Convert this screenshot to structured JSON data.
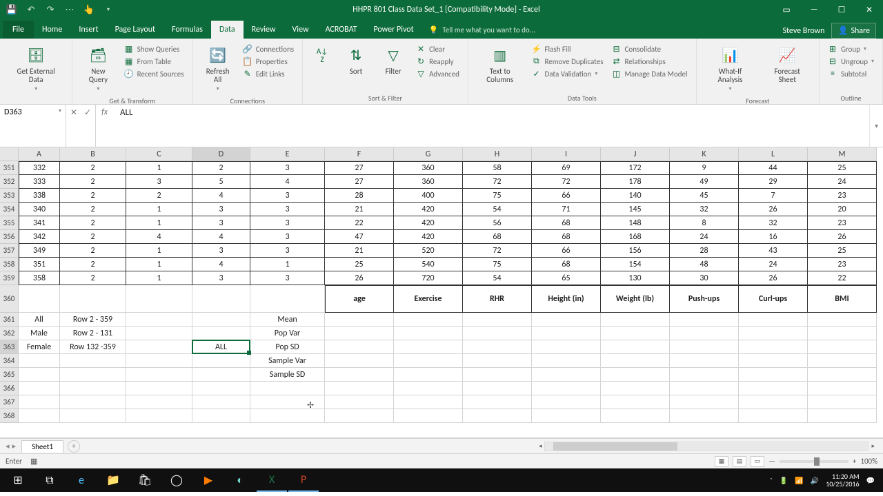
{
  "title": "HHPR 801 Class Data Set_1  [Compatibility Mode] - Excel",
  "user": "Steve Brown",
  "share": "Share",
  "tabs": {
    "file": "File",
    "home": "Home",
    "insert": "Insert",
    "pagelayout": "Page Layout",
    "formulas": "Formulas",
    "data": "Data",
    "review": "Review",
    "view": "View",
    "acrobat": "ACROBAT",
    "powerpivot": "Power Pivot"
  },
  "tellme": "Tell me what you want to do...",
  "ribbon": {
    "getdata": "Get External Data",
    "newquery": "New Query",
    "showqueries": "Show Queries",
    "fromtable": "From Table",
    "recent": "Recent Sources",
    "gt": "Get & Transform",
    "refresh": "Refresh All",
    "connections": "Connections",
    "properties": "Properties",
    "editlinks": "Edit Links",
    "conn": "Connections",
    "sort": "Sort",
    "filter": "Filter",
    "clear": "Clear",
    "reapply": "Reapply",
    "advanced": "Advanced",
    "sf": "Sort & Filter",
    "t2c": "Text to Columns",
    "flash": "Flash Fill",
    "dup": "Remove Duplicates",
    "valid": "Data Validation",
    "consol": "Consolidate",
    "rel": "Relationships",
    "model": "Manage Data Model",
    "dt": "Data Tools",
    "whatif": "What-If Analysis",
    "forecast": "Forecast Sheet",
    "fc": "Forecast",
    "group": "Group",
    "ungroup": "Ungroup",
    "subtotal": "Subtotal",
    "ol": "Outline"
  },
  "namebox": "D363",
  "formula": "ALL",
  "columns": [
    "A",
    "B",
    "C",
    "D",
    "E",
    "F",
    "G",
    "H",
    "I",
    "J",
    "K",
    "L",
    "M"
  ],
  "colclasses": [
    "col-A",
    "col-B",
    "col-C",
    "col-D",
    "col-E",
    "col-F",
    "col-G",
    "col-H",
    "col-I",
    "col-J",
    "col-K",
    "col-L",
    "col-M"
  ],
  "rows": [
    {
      "n": "351",
      "d": [
        "332",
        "2",
        "1",
        "2",
        "3",
        "27",
        "360",
        "58",
        "69",
        "172",
        "9",
        "44",
        "25"
      ],
      "b": true
    },
    {
      "n": "352",
      "d": [
        "333",
        "2",
        "3",
        "5",
        "4",
        "27",
        "360",
        "72",
        "72",
        "178",
        "49",
        "29",
        "24"
      ],
      "b": true
    },
    {
      "n": "353",
      "d": [
        "338",
        "2",
        "2",
        "4",
        "3",
        "28",
        "400",
        "75",
        "66",
        "140",
        "45",
        "7",
        "23"
      ],
      "b": true
    },
    {
      "n": "354",
      "d": [
        "340",
        "2",
        "1",
        "3",
        "3",
        "21",
        "420",
        "54",
        "71",
        "145",
        "32",
        "26",
        "20"
      ],
      "b": true
    },
    {
      "n": "355",
      "d": [
        "341",
        "2",
        "1",
        "3",
        "3",
        "22",
        "420",
        "56",
        "68",
        "148",
        "8",
        "32",
        "23"
      ],
      "b": true
    },
    {
      "n": "356",
      "d": [
        "342",
        "2",
        "4",
        "4",
        "3",
        "47",
        "420",
        "68",
        "68",
        "168",
        "24",
        "16",
        "26"
      ],
      "b": true
    },
    {
      "n": "357",
      "d": [
        "349",
        "2",
        "1",
        "3",
        "3",
        "21",
        "520",
        "72",
        "66",
        "156",
        "28",
        "43",
        "25"
      ],
      "b": true
    },
    {
      "n": "358",
      "d": [
        "351",
        "2",
        "1",
        "4",
        "1",
        "25",
        "540",
        "75",
        "68",
        "154",
        "48",
        "24",
        "23"
      ],
      "b": true
    },
    {
      "n": "359",
      "d": [
        "358",
        "2",
        "1",
        "3",
        "3",
        "26",
        "720",
        "54",
        "65",
        "130",
        "30",
        "26",
        "22"
      ],
      "b": true
    },
    {
      "n": "360",
      "d": [
        "",
        "",
        "",
        "",
        "",
        "age",
        "Exercise",
        "RHR",
        "Height (in)",
        "Weight (lb)",
        "Push-ups",
        "Curl-ups",
        "BMI"
      ],
      "b": false,
      "header": true,
      "tall": true
    },
    {
      "n": "361",
      "d": [
        "All",
        "Row 2 - 359",
        "",
        "",
        "Mean",
        "",
        "",
        "",
        "",
        "",
        "",
        "",
        ""
      ],
      "b": false
    },
    {
      "n": "362",
      "d": [
        "Male",
        "Row 2 - 131",
        "",
        "",
        "Pop Var",
        "",
        "",
        "",
        "",
        "",
        "",
        "",
        ""
      ],
      "b": false
    },
    {
      "n": "363",
      "d": [
        "Female",
        "Row 132 -359",
        "",
        "ALL",
        "Pop SD",
        "",
        "",
        "",
        "",
        "",
        "",
        "",
        ""
      ],
      "b": false,
      "active": 3
    },
    {
      "n": "364",
      "d": [
        "",
        "",
        "",
        "",
        "Sample Var",
        "",
        "",
        "",
        "",
        "",
        "",
        "",
        ""
      ],
      "b": false
    },
    {
      "n": "365",
      "d": [
        "",
        "",
        "",
        "",
        "Sample SD",
        "",
        "",
        "",
        "",
        "",
        "",
        "",
        ""
      ],
      "b": false
    },
    {
      "n": "366",
      "d": [
        "",
        "",
        "",
        "",
        "",
        "",
        "",
        "",
        "",
        "",
        "",
        "",
        ""
      ],
      "b": false
    },
    {
      "n": "367",
      "d": [
        "",
        "",
        "",
        "",
        "",
        "",
        "",
        "",
        "",
        "",
        "",
        "",
        ""
      ],
      "b": false
    },
    {
      "n": "368",
      "d": [
        "",
        "",
        "",
        "",
        "",
        "",
        "",
        "",
        "",
        "",
        "",
        "",
        ""
      ],
      "b": false
    }
  ],
  "sheet": "Sheet1",
  "status": "Enter",
  "zoom": "100%",
  "clock": {
    "time": "11:20 AM",
    "date": "10/25/2016"
  }
}
